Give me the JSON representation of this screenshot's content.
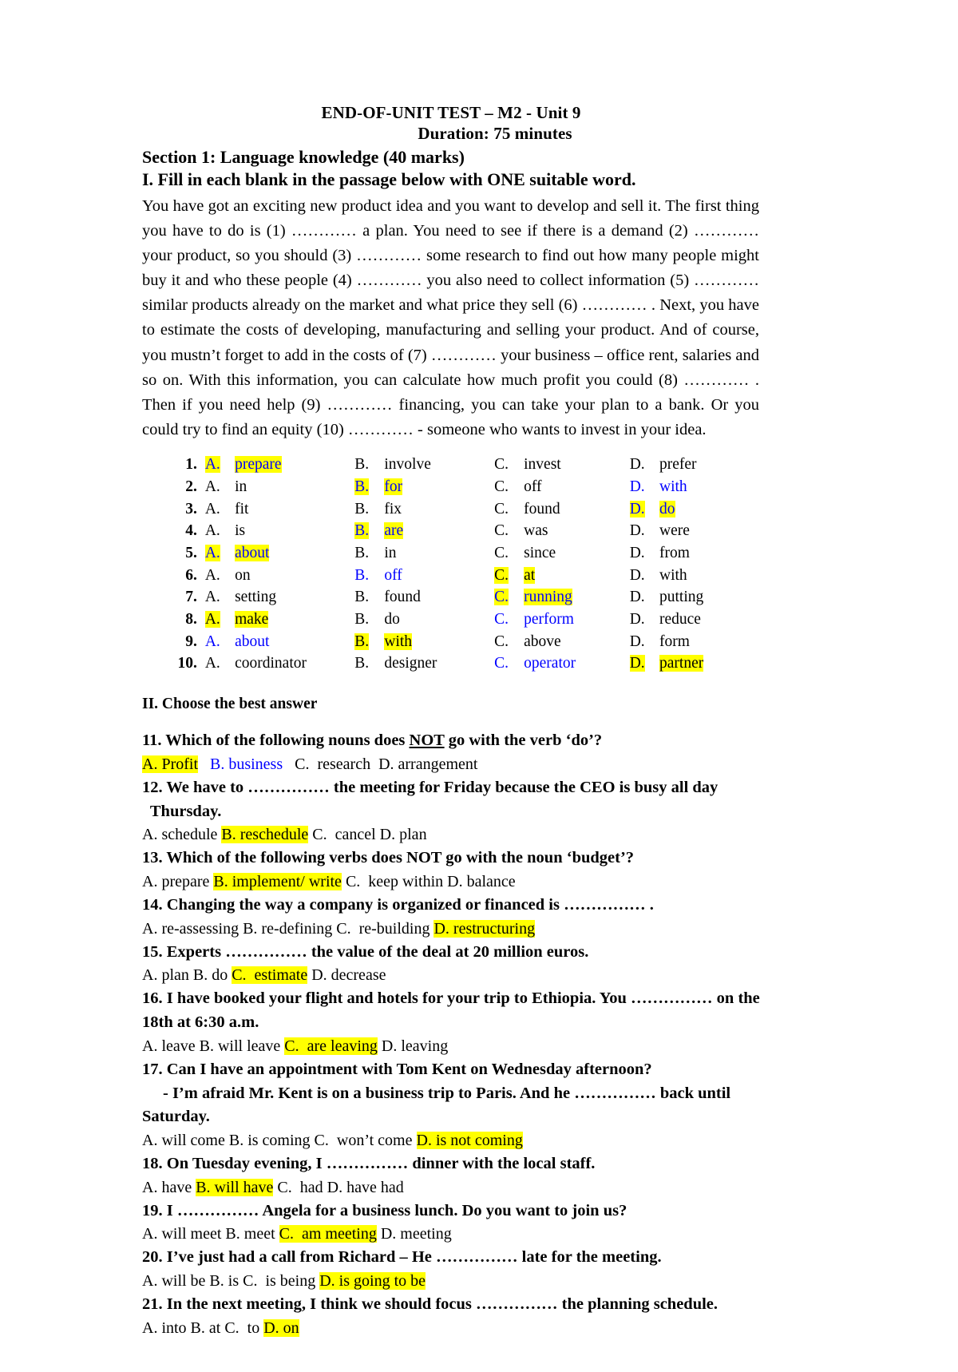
{
  "header": {
    "title": "END-OF-UNIT TEST – M2 - Unit 9",
    "duration": "Duration: 75 minutes",
    "section1": "Section 1: Language knowledge (40 marks)",
    "part1_heading": "I. Fill in each blank in the passage below with ONE suitable word."
  },
  "passage": {
    "text": "You have got an exciting new product idea and you want to develop and sell it. The first thing you have to do is (1) ………… a plan. You need to see if there is a demand (2) ………… your product, so you should (3) ………… some research to find out how many people might buy it and who these people (4) ………… you also need to collect information (5) ………… similar products already on the market and what price they sell (6) ………… . Next, you have to estimate the costs of developing, manufacturing and selling your product. And of course, you mustn’t forget to add in the costs of (7) ………… your business – office rent, salaries and so on. With this information, you can calculate how much profit you could (8) ………… . Then if you need help (9) ………… financing, you can take your plan to a bank. Or you could try to find an equity (10) ………… - someone who wants to invest in your idea."
  },
  "options_table": {
    "rows": [
      {
        "num": "1.",
        "options": [
          {
            "letter": "A.",
            "word": "prepare",
            "highlight": true,
            "blue": true
          },
          {
            "letter": "B.",
            "word": "involve",
            "highlight": false,
            "blue": false
          },
          {
            "letter": "C.",
            "word": "invest",
            "highlight": false,
            "blue": false
          },
          {
            "letter": "D.",
            "word": "prefer",
            "highlight": false,
            "blue": false
          }
        ]
      },
      {
        "num": "2.",
        "options": [
          {
            "letter": "A.",
            "word": "in",
            "highlight": false,
            "blue": false
          },
          {
            "letter": "B.",
            "word": "for",
            "highlight": true,
            "blue": true
          },
          {
            "letter": "C.",
            "word": "off",
            "highlight": false,
            "blue": false
          },
          {
            "letter": "D.",
            "word": "with",
            "highlight": false,
            "blue": true
          }
        ]
      },
      {
        "num": "3.",
        "options": [
          {
            "letter": "A.",
            "word": "fit",
            "highlight": false,
            "blue": false
          },
          {
            "letter": "B.",
            "word": "fix",
            "highlight": false,
            "blue": false
          },
          {
            "letter": "C.",
            "word": "found",
            "highlight": false,
            "blue": false
          },
          {
            "letter": "D.",
            "word": "do",
            "highlight": true,
            "blue": true
          }
        ]
      },
      {
        "num": "4.",
        "options": [
          {
            "letter": "A.",
            "word": "is",
            "highlight": false,
            "blue": false
          },
          {
            "letter": "B.",
            "word": "are",
            "highlight": true,
            "blue": true
          },
          {
            "letter": "C.",
            "word": "was",
            "highlight": false,
            "blue": false
          },
          {
            "letter": "D.",
            "word": "were",
            "highlight": false,
            "blue": false
          }
        ]
      },
      {
        "num": "5.",
        "options": [
          {
            "letter": "A.",
            "word": "about",
            "highlight": true,
            "blue": true
          },
          {
            "letter": "B.",
            "word": "in",
            "highlight": false,
            "blue": false
          },
          {
            "letter": "C.",
            "word": "since",
            "highlight": false,
            "blue": false
          },
          {
            "letter": "D.",
            "word": "from",
            "highlight": false,
            "blue": false
          }
        ]
      },
      {
        "num": "6.",
        "options": [
          {
            "letter": "A.",
            "word": "on",
            "highlight": false,
            "blue": false
          },
          {
            "letter": "B.",
            "word": "off",
            "highlight": false,
            "blue": true
          },
          {
            "letter": "C.",
            "word": "at",
            "highlight": true,
            "blue": false
          },
          {
            "letter": "D.",
            "word": "with",
            "highlight": false,
            "blue": false
          }
        ]
      },
      {
        "num": "7.",
        "options": [
          {
            "letter": "A.",
            "word": "setting",
            "highlight": false,
            "blue": false
          },
          {
            "letter": "B.",
            "word": "found",
            "highlight": false,
            "blue": false
          },
          {
            "letter": "C.",
            "word": "running",
            "highlight": true,
            "blue": true
          },
          {
            "letter": "D.",
            "word": "putting",
            "highlight": false,
            "blue": false
          }
        ]
      },
      {
        "num": "8.",
        "options": [
          {
            "letter": "A.",
            "word": "make",
            "highlight": true,
            "blue": false
          },
          {
            "letter": "B.",
            "word": "do",
            "highlight": false,
            "blue": false
          },
          {
            "letter": "C.",
            "word": "perform",
            "highlight": false,
            "blue": true
          },
          {
            "letter": "D.",
            "word": "reduce",
            "highlight": false,
            "blue": false
          }
        ]
      },
      {
        "num": "9.",
        "options": [
          {
            "letter": "A.",
            "word": "about",
            "highlight": false,
            "blue": true
          },
          {
            "letter": "B.",
            "word": "with",
            "highlight": true,
            "blue": false
          },
          {
            "letter": "C.",
            "word": "above",
            "highlight": false,
            "blue": false
          },
          {
            "letter": "D.",
            "word": "form",
            "highlight": false,
            "blue": false
          }
        ]
      },
      {
        "num": "10.",
        "options": [
          {
            "letter": "A.",
            "word": "coordinator",
            "highlight": false,
            "blue": false
          },
          {
            "letter": "B.",
            "word": "designer",
            "highlight": false,
            "blue": false
          },
          {
            "letter": "C.",
            "word": "operator",
            "highlight": false,
            "blue": true
          },
          {
            "letter": "D.",
            "word": "partner",
            "highlight": true,
            "blue": false
          }
        ]
      }
    ]
  },
  "part2": {
    "heading": "II. Choose the best answer",
    "questions": [
      {
        "stem_html": "11. Which of the following nouns does <span class=\"u\">NOT</span> go with the verb ‘do’?",
        "choices_html": "<span class=\"hl\">A. Profit</span> &nbsp; <span class=\"blue\">B. business</span> &nbsp; C.&nbsp; research &nbsp;D. arrangement"
      },
      {
        "stem_html": "12. We have to …………… the meeting for Friday because the CEO is busy all day<br>&nbsp; Thursday.",
        "choices_html": "A. schedule <span class=\"hl\">B. reschedule</span> C.&nbsp; cancel D. plan"
      },
      {
        "stem_html": "13. Which of the following verbs does NOT go with the noun ‘budget’?",
        "choices_html": "A. prepare <span class=\"hl\">B. implement/ write</span> C.&nbsp; keep within D. balance"
      },
      {
        "stem_html": "14. Changing the way a company is organized or financed is …………… .",
        "choices_html": "A. re-assessing B. re-defining C.&nbsp; re-building <span class=\"hl\">D. restructuring</span>"
      },
      {
        "stem_html": "15. Experts …………… the value of the deal at 20 million euros.",
        "choices_html": "A. plan B. do <span class=\"hl\">C.&nbsp; estimate</span> D. decrease"
      },
      {
        "stem_html": "16. I have booked your flight and hotels for your trip to Ethiopia. You …………… on the<br>18th at 6:30 a.m.",
        "choices_html": "A. leave B. will leave <span class=\"hl\">C.&nbsp; are leaving</span> D. leaving"
      },
      {
        "stem_html": "17. Can I have an appointment with Tom Kent on Wednesday afternoon?<br><span class=\"indent-dash\"></span>- I’m afraid Mr. Kent is on a business trip to Paris. And he …………… back until<br>Saturday.",
        "choices_html": "A. will come B. is coming C.&nbsp; won’t come <span class=\"hl\">D. is not coming</span>"
      },
      {
        "stem_html": "18. On Tuesday evening, I …………… dinner with the local staff.",
        "choices_html": "A. have <span class=\"hl\">B. will have</span> C.&nbsp; had D. have had"
      },
      {
        "stem_html": "19. I …………… Angela for a business lunch. Do you want to join us?",
        "choices_html": "A. will meet B. meet <span class=\"hl\">C.&nbsp; am meeting</span> D. meeting"
      },
      {
        "stem_html": "20. I’ve just had a call from Richard – He …………… late for the meeting.",
        "choices_html": "A. will be B. is C.&nbsp; is being <span class=\"hl\">D. is going to be</span>"
      },
      {
        "stem_html": "21. In the next meeting, I think we should focus …………… the planning schedule.",
        "choices_html": "A. into B. at C.&nbsp; to <span class=\"hl\">D. on</span>"
      }
    ]
  },
  "colors": {
    "highlight": "#ffff00",
    "blue": "#0000ff",
    "text": "#000000",
    "background": "#ffffff"
  }
}
